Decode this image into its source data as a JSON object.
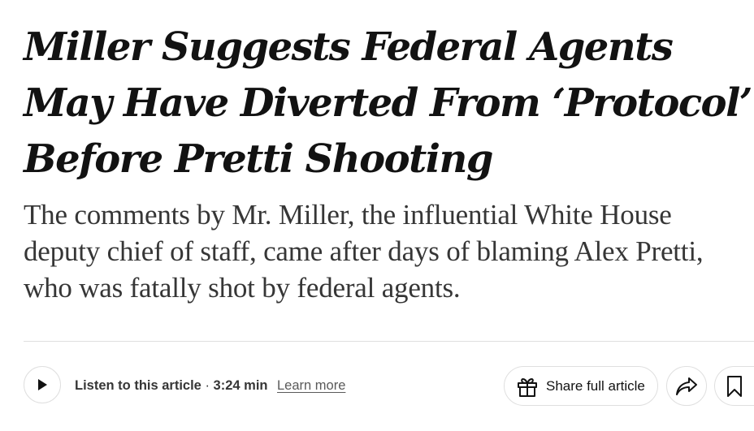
{
  "article": {
    "headline": "Miller Suggests Federal Agents May Have Diverted From ‘Protocol’ Before Pretti Shooting",
    "summary": "The comments by Mr. Miller, the influential White House deputy chief of staff, came after days of blaming Alex Pretti, who was fatally shot by federal agents."
  },
  "audio": {
    "listen_label": "Listen to this article",
    "separator": " · ",
    "duration": "3:24 min",
    "learn_more": "Learn more",
    "play_icon": "play-icon"
  },
  "actions": {
    "share_full_label": "Share full article",
    "gift_icon": "gift-icon",
    "share_icon": "share-arrow-icon",
    "save_icon": "bookmark-icon"
  },
  "colors": {
    "text_primary": "#121212",
    "text_secondary": "#363636",
    "border": "#dfdfdf"
  }
}
